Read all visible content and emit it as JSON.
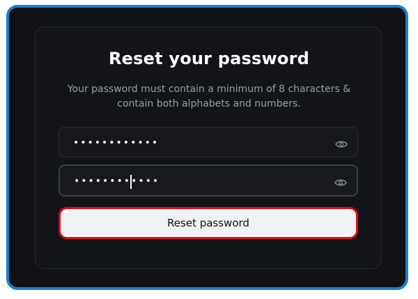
{
  "form": {
    "title": "Reset your password",
    "subtitle": "Your password must contain a minimum of 8 characters & contain both alphabets and numbers.",
    "password_value": "••••••••••••",
    "confirm_value": "••••••••••••",
    "submit_label": "Reset password"
  },
  "colors": {
    "frame_border": "#1a7fd0",
    "background": "#0f1115",
    "button_outline": "#e10b14",
    "button_bg": "#f1f2f6"
  },
  "icons": {
    "show_password": "eye-icon"
  }
}
